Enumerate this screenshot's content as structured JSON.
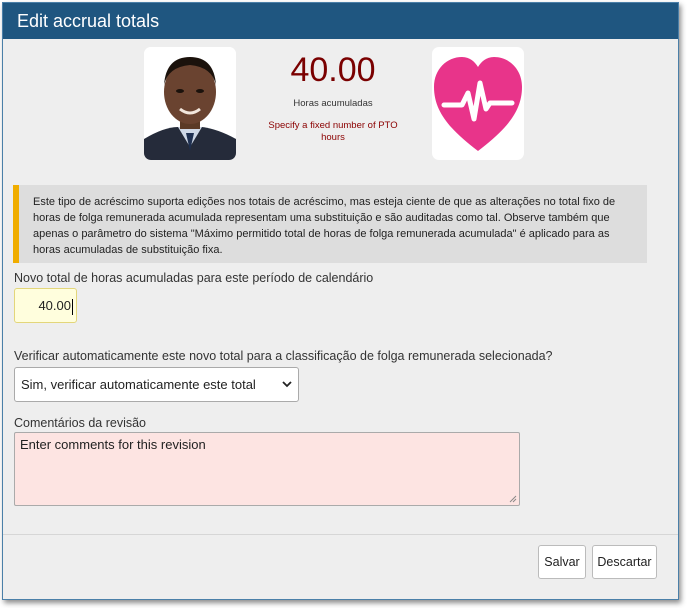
{
  "dialog": {
    "title": "Edit accrual totals"
  },
  "summary": {
    "total": "40.00",
    "caption": "Horas acumuladas",
    "hint": "Specify a fixed number of PTO hours",
    "left_image": "employee-photo",
    "right_icon": "heart-pulse-icon",
    "accent_color": "#e8348a"
  },
  "notice": {
    "text": "Este tipo de acréscimo suporta edições nos totais de acréscimo, mas esteja ciente de que as alterações no total fixo de horas de folga remunerada acumulada representam uma substituição e são auditadas como tal. Observe também que apenas o parâmetro do sistema \"Máximo permitido total de horas de folga remunerada acumulada\" é aplicado para as horas acumuladas de substituição fixa.",
    "accent_color": "#f0ad00"
  },
  "form": {
    "hours_label": "Novo total de horas acumuladas para este período de calendário",
    "hours_value": "40.00",
    "verify_label": "Verificar automaticamente este novo total para a classificação de folga remunerada selecionada?",
    "verify_selected": "Sim, verificar automaticamente este total",
    "comments_label": "Comentários da revisão",
    "comments_placeholder": "Enter comments for this revision"
  },
  "footer": {
    "save_label": "Salvar",
    "discard_label": "Descartar"
  }
}
